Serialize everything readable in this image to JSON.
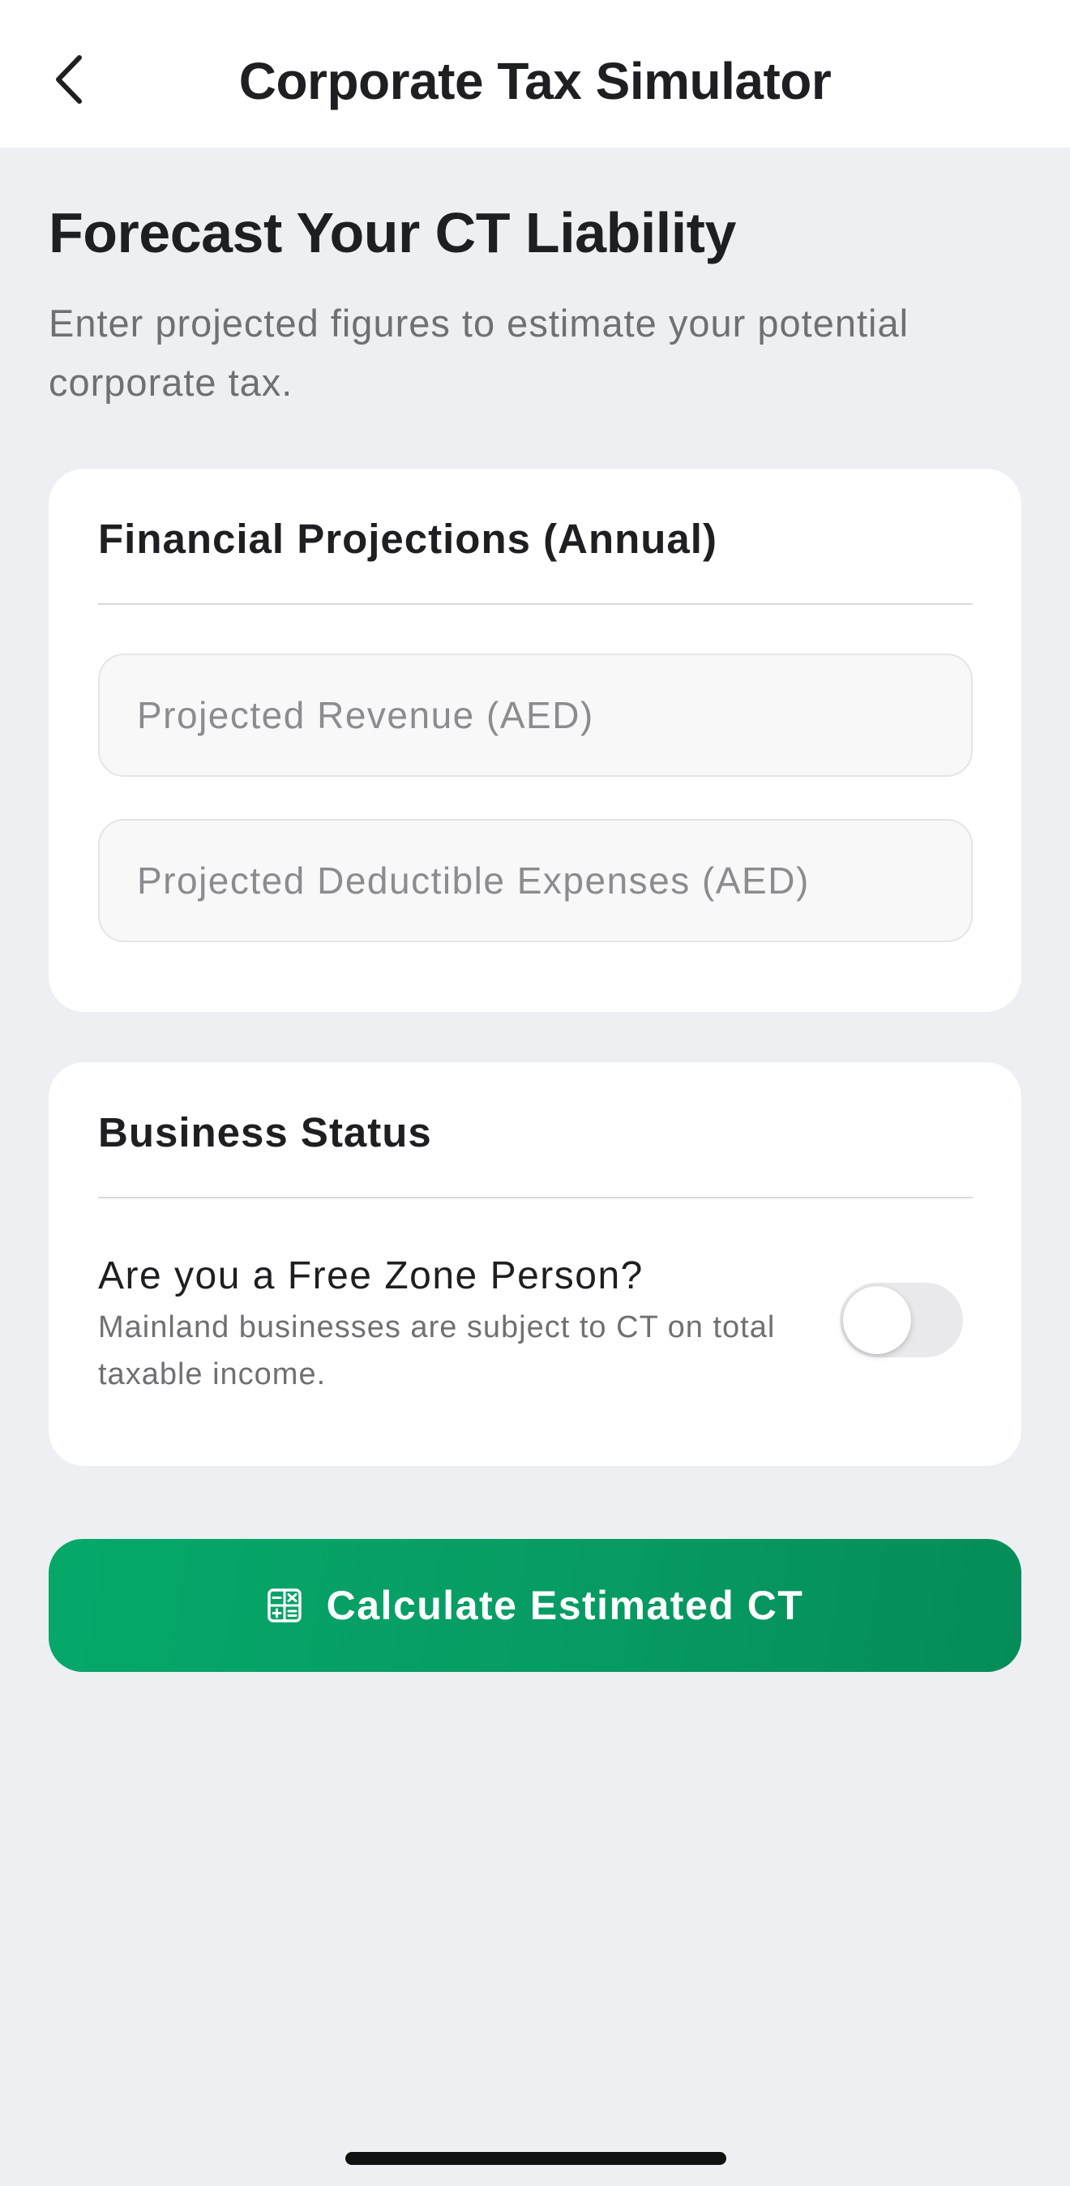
{
  "header": {
    "title": "Corporate Tax Simulator",
    "back_icon": "chevron-left-icon"
  },
  "intro": {
    "title": "Forecast Your CT Liability",
    "subtitle": "Enter projected figures to estimate your potential corporate tax."
  },
  "projections": {
    "heading": "Financial Projections (Annual)",
    "revenue": {
      "value": "",
      "placeholder": "Projected Revenue (AED)"
    },
    "expenses": {
      "value": "",
      "placeholder": "Projected Deductible Expenses (AED)"
    }
  },
  "status": {
    "heading": "Business Status",
    "question": "Are you a Free Zone Person?",
    "hint": "Mainland businesses are subject to CT on total taxable income.",
    "free_zone_enabled": false
  },
  "actions": {
    "calculate_label": "Calculate Estimated CT",
    "calculate_icon": "calculator-icon",
    "accent_color": "#079B63"
  }
}
